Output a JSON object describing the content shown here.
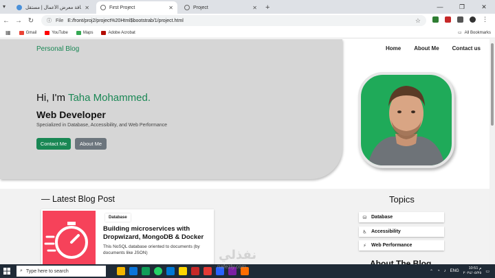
{
  "browser": {
    "tabs": [
      {
        "title": "إضافة معرض الأعمال | مستقل",
        "active": false
      },
      {
        "title": "First Project",
        "active": true
      },
      {
        "title": "Project",
        "active": false
      }
    ],
    "address": {
      "info_label": "File",
      "url": "E:/front/proj2/project%20Html$bootstrab/1/project.html"
    },
    "bookmarks": [
      "Gmail",
      "YouTube",
      "Maps",
      "Adobe Acrobat"
    ],
    "all_bookmarks": "All Bookmarks"
  },
  "page": {
    "brand": "Personal Blog",
    "nav": [
      "Home",
      "About Me",
      "Contact us"
    ],
    "hero": {
      "greeting": "Hi, I'm ",
      "name": "Taha Mohammed.",
      "role": "Web Developer",
      "specialty": "Specialized in Database, Accessibility, and Web Performance",
      "contact_btn": "Contact Me",
      "about_btn": "About Me"
    },
    "latest": {
      "title": "Latest Blog Post",
      "badge": "Database",
      "post_title": "Building microservices with Dropwizard, MongoDB & Docker",
      "post_desc": "This NoSQL database oriented to documents (by documents like JSON)"
    },
    "topics": {
      "title": "Topics",
      "items": [
        "Database",
        "Accessibility",
        "Web Performance"
      ]
    },
    "about_title": "About The Blog"
  },
  "taskbar": {
    "search_placeholder": "Type here to search",
    "lang": "ENG",
    "time": "10:51 م",
    "date": "٢٠٢٤/٠٥/٢٥"
  },
  "watermark": {
    "arabic": "نفذلي",
    "latin": "nafezly.com"
  },
  "colors": {
    "accent": "#198754",
    "secondary": "#6c757d",
    "hero_grey": "#d6d6d6",
    "card_image": "#f6425a"
  }
}
